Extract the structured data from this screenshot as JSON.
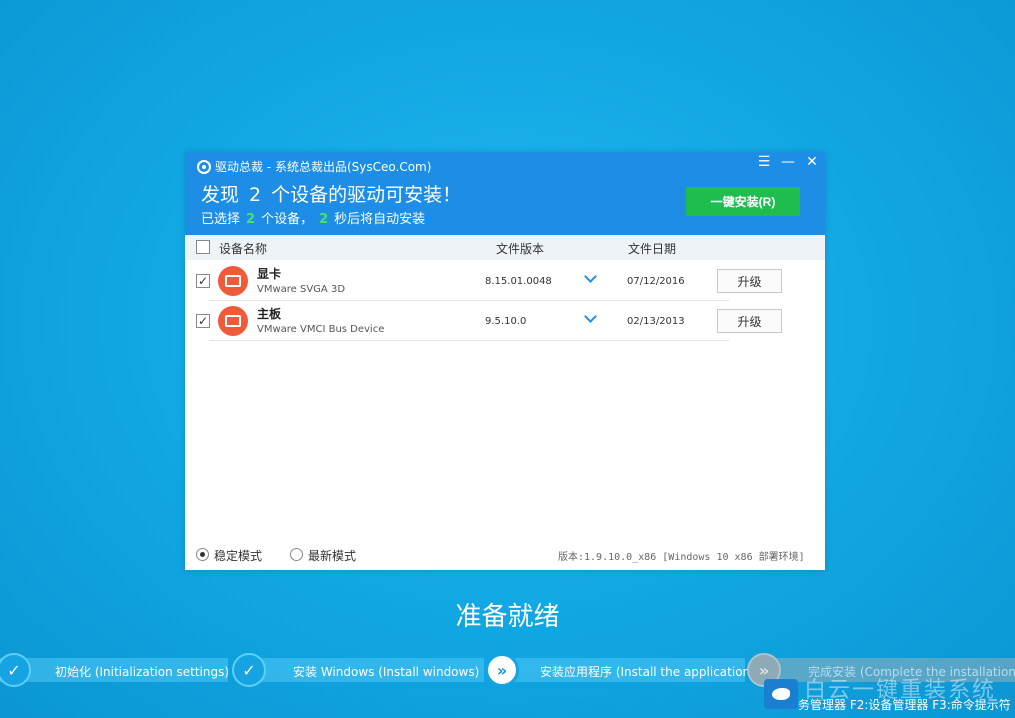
{
  "dialog": {
    "title": "驱动总裁 - 系统总裁出品(SysCeo.Com)",
    "controls": {
      "menu": "☰",
      "minimize": "—",
      "close": "✕"
    },
    "headline_pre": "发现",
    "device_count": "2",
    "headline_post": "个设备的驱动可安装！",
    "sub_pre": "已选择",
    "selected_count": "2",
    "sub_mid": "个设备，",
    "seconds": "2",
    "sub_post": "秒后将自动安装",
    "install_button": "一键安装(R)"
  },
  "table": {
    "columns": {
      "name": "设备名称",
      "version": "文件版本",
      "date": "文件日期"
    },
    "rows": [
      {
        "checked": "✓",
        "name": "显卡",
        "model": "VMware SVGA 3D",
        "version": "8.15.01.0048",
        "date": "07/12/2016",
        "action": "升级",
        "icon": "display-icon"
      },
      {
        "checked": "✓",
        "name": "主板",
        "model": "VMware VMCI Bus Device",
        "version": "9.5.10.0",
        "date": "02/13/2013",
        "action": "升级",
        "icon": "motherboard-icon"
      }
    ]
  },
  "footer": {
    "mode_stable": "稳定模式",
    "mode_latest": "最新模式",
    "selected_mode": "stable",
    "version_text": "版本:1.9.10.0_x86 [Windows 10 x86 部署环境]"
  },
  "status_text": "准备就绪",
  "steps": [
    {
      "label": "初始化 (Initialization settings)",
      "state": "done"
    },
    {
      "label": "安装 Windows (Install windows)",
      "state": "done"
    },
    {
      "label": "安装应用程序 (Install the application)",
      "state": "active"
    },
    {
      "label": "完成安装 (Complete the installation)",
      "state": "pending"
    }
  ],
  "watermark": "白云一键重装系统",
  "hint_text": "务管理器 F2:设备管理器 F3:命令提示符",
  "colors": {
    "accent": "#1d8de6",
    "install_green": "#1fbc4e",
    "count_green": "#4ee06a",
    "device_icon": "#f05a38"
  }
}
